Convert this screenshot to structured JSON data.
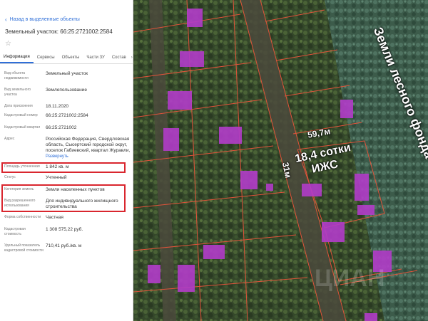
{
  "panel": {
    "back_label": "Назад в выделенные объекты",
    "title": "Земельный участок: 66:25:2721002:2584",
    "tabs": [
      {
        "label": "Информация",
        "active": true
      },
      {
        "label": "Сервисы",
        "active": false
      },
      {
        "label": "Объекты",
        "active": false
      },
      {
        "label": "Части ЗУ",
        "active": false
      },
      {
        "label": "Состав",
        "active": false
      }
    ],
    "fields": [
      {
        "label": "Вид объекта недвижимости",
        "value": "Земельный участок"
      },
      {
        "label": "Вид земельного участка",
        "value": "Землепользование"
      },
      {
        "label": "Дата присвоения",
        "value": "18.11.2020"
      },
      {
        "label": "Кадастровый номер",
        "value": "66:25:2721002:2584"
      },
      {
        "label": "Кадастровый квартал",
        "value": "66:25:2721002"
      },
      {
        "label": "Адрес",
        "value": "Российская Федерация, Свердловская область, Сысертский городской округ, поселок Габиевский, квартал Журавли,",
        "link": "Развернуть"
      },
      {
        "label": "Площадь уточненная",
        "value": "1 842 кв. м"
      },
      {
        "label": "Статус",
        "value": "Учтенный"
      },
      {
        "label": "Категория земель",
        "value": "Земли населенных пунктов"
      },
      {
        "label": "Вид разрешенного использования",
        "value": "Для индивидуального жилищного строительства"
      },
      {
        "label": "Форма собственности",
        "value": "Частная"
      },
      {
        "label": "Кадастровая стоимость",
        "value": "1 308 575,22 руб."
      },
      {
        "label": "Удельный показатель кадастровой стоимости",
        "value": "710,41 руб./кв. м"
      }
    ]
  },
  "map": {
    "forest_label": "Земли лесного фонда",
    "width_label": "59,7м",
    "road_label": "31м",
    "plot_label_line1": "18,4 сотки",
    "plot_label_line2": "ИЖС",
    "watermark": "ЦИАН"
  },
  "colors": {
    "accent": "#2f6fd8",
    "highlight": "#d9262e",
    "parcel_line": "#e0533a",
    "building": "#b23cc9"
  }
}
